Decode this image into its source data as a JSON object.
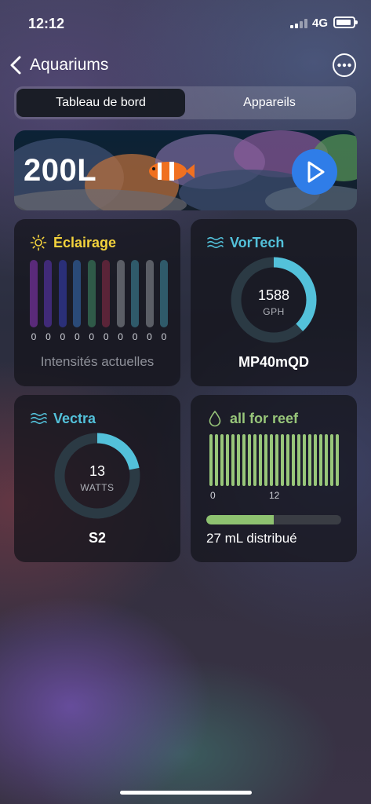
{
  "status_bar": {
    "time": "12:12",
    "network": "4G"
  },
  "nav": {
    "back_label": "Aquariums"
  },
  "tabs": [
    {
      "label": "Tableau de bord",
      "active": true
    },
    {
      "label": "Appareils",
      "active": false
    }
  ],
  "banner": {
    "tank_name": "200L"
  },
  "lighting": {
    "title": "Éclairage",
    "title_color": "#f3d23c",
    "channels": [
      {
        "value": "0",
        "color": "#5a2a7a"
      },
      {
        "value": "0",
        "color": "#402a78"
      },
      {
        "value": "0",
        "color": "#2a2f78"
      },
      {
        "value": "0",
        "color": "#2a4a78"
      },
      {
        "value": "0",
        "color": "#2f5a48"
      },
      {
        "value": "0",
        "color": "#5a2438"
      },
      {
        "value": "0",
        "color": "#5b5e66"
      },
      {
        "value": "0",
        "color": "#2f5a6a"
      },
      {
        "value": "0",
        "color": "#5b5e66"
      },
      {
        "value": "0",
        "color": "#2f5a6a"
      }
    ],
    "caption": "Intensités actuelles"
  },
  "vortech": {
    "title": "VorTech",
    "title_color": "#53c1da",
    "value": "1588",
    "unit": "GPH",
    "gauge_fraction": 0.38,
    "model": "MP40mQD"
  },
  "vectra": {
    "title": "Vectra",
    "title_color": "#53c1da",
    "value": "13",
    "unit": "WATTS",
    "gauge_fraction": 0.22,
    "model": "S2"
  },
  "doser": {
    "title": "all for reef",
    "title_color": "#98c67a",
    "bar_count": 24,
    "axis_labels": [
      "0",
      "12"
    ],
    "progress_fraction": 0.5,
    "dosed_text": "27 mL distribué"
  }
}
